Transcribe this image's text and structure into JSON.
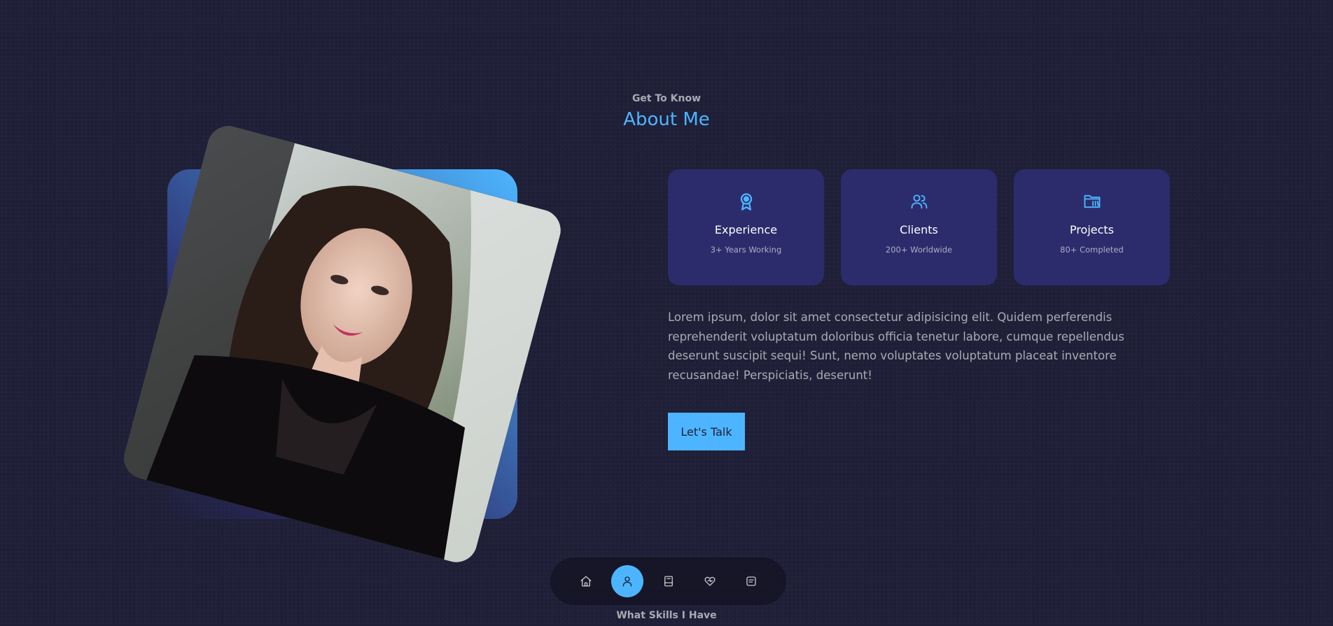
{
  "header": {
    "subtitle": "Get To Know",
    "title": "About Me"
  },
  "cards": [
    {
      "icon": "award-icon",
      "title": "Experience",
      "subtitle": "3+ Years Working"
    },
    {
      "icon": "users-icon",
      "title": "Clients",
      "subtitle": "200+ Worldwide"
    },
    {
      "icon": "folder-icon",
      "title": "Projects",
      "subtitle": "80+ Completed"
    }
  ],
  "about": {
    "text": "Lorem ipsum, dolor sit amet consectetur adipisicing elit. Quidem perferendis reprehenderit voluptatum doloribus officia tenetur labore, cumque repellendus deserunt suscipit sequi! Sunt, nemo voluptates voluptatum placeat inventore recusandae! Perspiciatis, deserunt!",
    "cta_label": "Let's Talk"
  },
  "nav": {
    "items": [
      "home-icon",
      "user-icon",
      "book-icon",
      "heart-icon",
      "message-icon"
    ],
    "active": "user-icon"
  },
  "next_section": {
    "subtitle": "What Skills I Have"
  },
  "colors": {
    "background": "#1f1f38",
    "primary": "#4db5ff",
    "card": "#2c2c6c"
  }
}
